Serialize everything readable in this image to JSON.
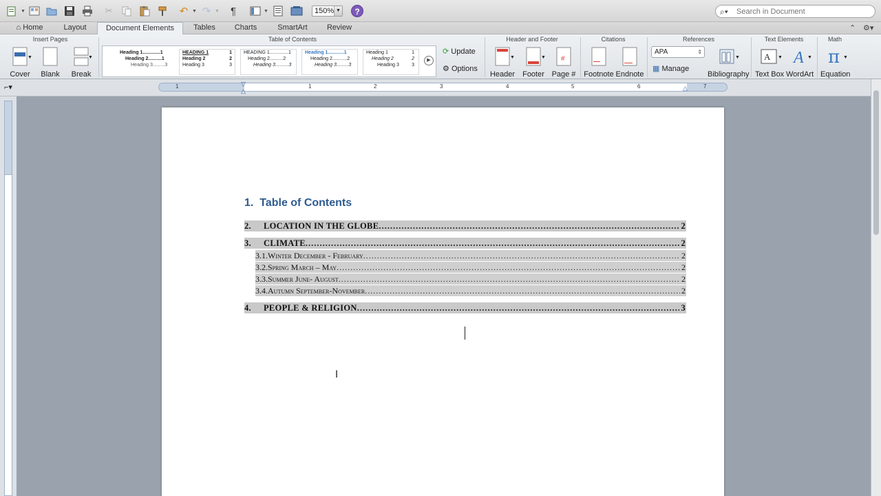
{
  "toolbar": {
    "zoom": "150%",
    "help_icon": "?",
    "search_placeholder": "Search in Document"
  },
  "ribbon_tabs": {
    "items": [
      "Home",
      "Layout",
      "Document Elements",
      "Tables",
      "Charts",
      "SmartArt",
      "Review"
    ],
    "active": "Document Elements"
  },
  "ribbon": {
    "groups": {
      "insert_pages": "Insert Pages",
      "table_of_contents": "Table of Contents",
      "header_footer": "Header and Footer",
      "citations": "Citations",
      "references": "References",
      "text_elements": "Text Elements",
      "math": "Math"
    },
    "insert_pages": {
      "cover": "Cover",
      "blank": "Blank",
      "break": "Break"
    },
    "toc_styles": [
      {
        "h1": "Heading 1.............1",
        "h2": "Heading 2..........1",
        "h3": "Heading 3.........3"
      },
      {
        "h1": "HEADING 1",
        "h1p": "1",
        "h2": "Heading 2",
        "h2p": "2",
        "h3": "Heading 3",
        "h3p": "3"
      },
      {
        "h1": "HEADING 1..............1",
        "h2": "Heading 2..........2",
        "h3": "Heading 3..........3"
      },
      {
        "h1": "Heading 1............1",
        "h2": "Heading 2...........2",
        "h3": "Heading 3.........3"
      },
      {
        "h1": "Heading 1",
        "h1p": "1",
        "h2": "Heading 2",
        "h2p": "2",
        "h3": "Heading 3",
        "h3p": "3"
      }
    ],
    "toc_update": "Update",
    "toc_options": "Options",
    "header_footer": {
      "header": "Header",
      "footer": "Footer",
      "page_num": "Page #"
    },
    "citations": {
      "footnote": "Footnote",
      "endnote": "Endnote"
    },
    "references": {
      "style": "APA",
      "manage": "Manage",
      "bibliography": "Bibliography"
    },
    "text_elements": {
      "text_box": "Text Box",
      "wordart": "WordArt"
    },
    "math": {
      "equation": "Equation"
    }
  },
  "ruler": {
    "numbers": [
      "1",
      "1",
      "2",
      "3",
      "4",
      "5",
      "6",
      "7"
    ]
  },
  "document": {
    "heading_number": "1.",
    "heading": "Table of Contents",
    "toc": [
      {
        "level": 1,
        "num": "2.",
        "text": "LOCATION IN THE GLOBE",
        "page": "2"
      },
      {
        "level": 1,
        "num": "3.",
        "text": "CLIMATE",
        "page": "2"
      },
      {
        "level": 2,
        "num": "3.1.",
        "text": "Winter December - February",
        "page": "2"
      },
      {
        "level": 2,
        "num": "3.2.",
        "text": "Spring March – May",
        "page": "2"
      },
      {
        "level": 2,
        "num": "3.3.",
        "text": "Summer June- August",
        "page": "2"
      },
      {
        "level": 2,
        "num": "3.4.",
        "text": "Autumn September-November",
        "page": "2"
      },
      {
        "level": 1,
        "num": "4.",
        "text": "PEOPLE & RELIGION",
        "page": "3"
      }
    ]
  }
}
